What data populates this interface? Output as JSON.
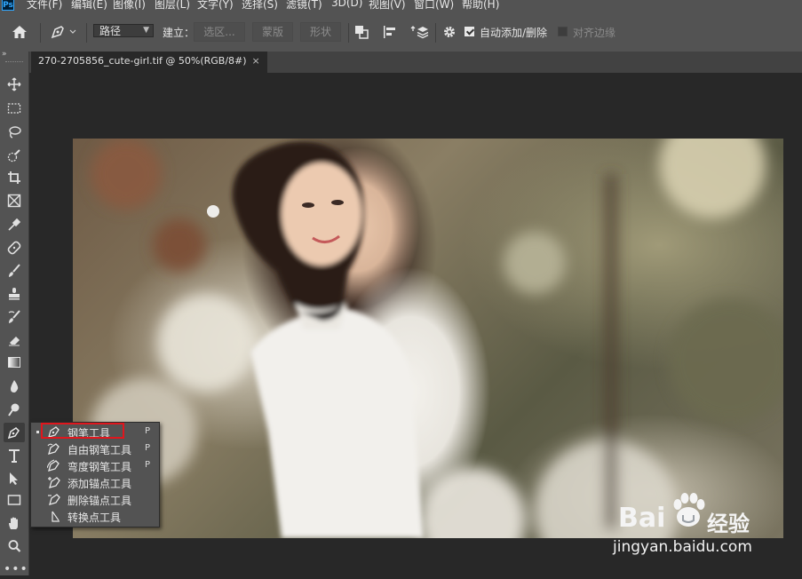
{
  "app": {
    "logo": "Ps"
  },
  "menubar": {
    "items": [
      "文件(F)",
      "编辑(E)",
      "图像(I)",
      "图层(L)",
      "文字(Y)",
      "选择(S)",
      "滤镜(T)",
      "3D(D)",
      "视图(V)",
      "窗口(W)",
      "帮助(H)"
    ]
  },
  "options": {
    "mode_value": "路径",
    "make_label": "建立：",
    "selection_btn": "选区...",
    "mask_btn": "蒙版",
    "shape_btn": "形状",
    "auto_add_delete_label": "自动添加/删除",
    "auto_add_delete_checked": true,
    "align_edges_label": "对齐边缘",
    "align_edges_checked": false
  },
  "document": {
    "tab_title": "270-2705856_cute-girl.tif @ 50%(RGB/8#)",
    "close_glyph": "×"
  },
  "flyout": {
    "items": [
      {
        "label": "钢笔工具",
        "key": "P",
        "icon": "pen-icon",
        "active": true
      },
      {
        "label": "自由钢笔工具",
        "key": "P",
        "icon": "freeform-pen-icon",
        "active": false
      },
      {
        "label": "弯度钢笔工具",
        "key": "P",
        "icon": "curvature-pen-icon",
        "active": false
      },
      {
        "label": "添加锚点工具",
        "key": "",
        "icon": "add-anchor-icon",
        "active": false
      },
      {
        "label": "删除锚点工具",
        "key": "",
        "icon": "delete-anchor-icon",
        "active": false
      },
      {
        "label": "转换点工具",
        "key": "",
        "icon": "convert-point-icon",
        "active": false
      }
    ]
  },
  "watermark": {
    "brand_left": "Bai",
    "brand_right": "经验",
    "url": "jingyan.baidu.com"
  },
  "colors": {
    "highlight": "#e0161d",
    "panel": "#535353",
    "workspace": "#282828"
  }
}
